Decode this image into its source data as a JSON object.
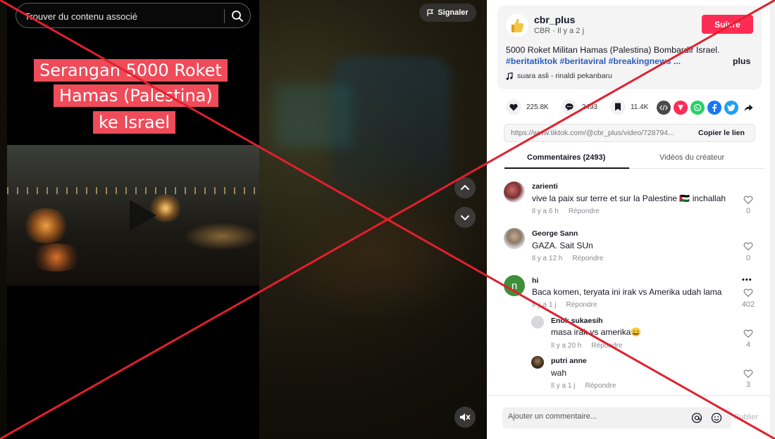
{
  "video": {
    "search_placeholder": "Trouver du contenu associé",
    "report_label": "Signaler",
    "caption_lines": [
      "Serangan 5000 Roket",
      "Hamas (Palestina)",
      "ke Israel"
    ]
  },
  "post": {
    "username": "cbr_plus",
    "nickname": "CBR",
    "time": "Il y a 2 j",
    "sub_line": "CBR · Il y a 2 j",
    "follow_label": "Suivre",
    "description": "5000 Roket Militan Hamas (Palestina) Bombardir Israel.",
    "hashtags": "#beritatiktok #beritaviral #breakingnews ...",
    "more_label": "plus",
    "music": "suara asli - rinaldi pekanbaru"
  },
  "stats": {
    "likes": "225.8K",
    "comments": "2493",
    "bookmarks": "11.4K"
  },
  "share_icons": [
    {
      "name": "embed-icon",
      "color": "#4a4a4a"
    },
    {
      "name": "send-icon",
      "color": "#fe2c55"
    },
    {
      "name": "whatsapp-icon",
      "color": "#25d366"
    },
    {
      "name": "facebook-icon",
      "color": "#1877f2"
    },
    {
      "name": "twitter-icon",
      "color": "#1da1f2"
    },
    {
      "name": "share-arrow-icon",
      "color": "#161823"
    }
  ],
  "link": {
    "url": "https://www.tiktok.com/@cbr_plus/video/728794...",
    "copy_label": "Copier le lien"
  },
  "tabs": {
    "comments": "Commentaires (2493)",
    "creator": "Vidéos du créateur"
  },
  "comments": [
    {
      "user": "zarienti",
      "text": "vive la paix sur terre et sur la Palestine 🇵🇸 inchallah",
      "time": "Il y a 6 h",
      "reply": "Répondre",
      "likes": "0"
    },
    {
      "user": "George Sann",
      "text": "GAZA. Sait SUn",
      "time": "Il y a 12 h",
      "reply": "Répondre",
      "likes": "0"
    },
    {
      "user": "hi",
      "avatar_letter": "n",
      "text": "Baca komen, teryata ini irak vs Amerika udah lama",
      "time": "Il y a 1 j",
      "reply": "Répondre",
      "likes": "402",
      "more": "•••"
    },
    {
      "user": "Enok sukaesih",
      "text": "masa irak vs amerika😄",
      "time": "Il y a 20 h",
      "reply": "Répondre",
      "likes": "4"
    },
    {
      "user": "putri anne",
      "text": "wah",
      "time": "Il y a 1 j",
      "reply": "Répondre",
      "likes": "3"
    }
  ],
  "footer": {
    "input_placeholder": "Ajouter un commentaire...",
    "post_label": "Publier"
  },
  "colors": {
    "accent": "#fe2c55",
    "hashtag": "#2b5db9",
    "cross": "#e0202e"
  }
}
